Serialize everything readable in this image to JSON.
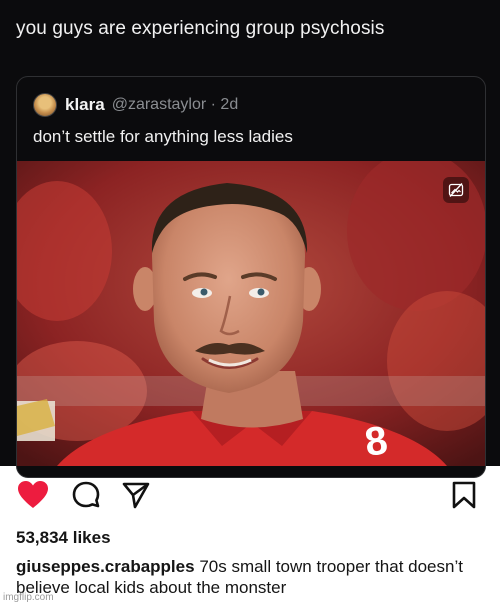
{
  "post": {
    "text": "you guys are experiencing group psychosis"
  },
  "quote": {
    "display_name": "klara",
    "handle_time": "@zarastaylor · 2d",
    "text": "don’t settle for anything less ladies",
    "image_alt_badge": "alt-text-icon"
  },
  "actions": {
    "icons": [
      "heart-icon",
      "comment-icon",
      "share-icon",
      "bookmark-icon"
    ],
    "heart_color": "#ed1c3f"
  },
  "likes": "53,834 likes",
  "caption": {
    "username": "giuseppes.crabapples",
    "text": "70s small town trooper that doesn’t believe local kids about the monster"
  },
  "watermark": "imgflip.com"
}
